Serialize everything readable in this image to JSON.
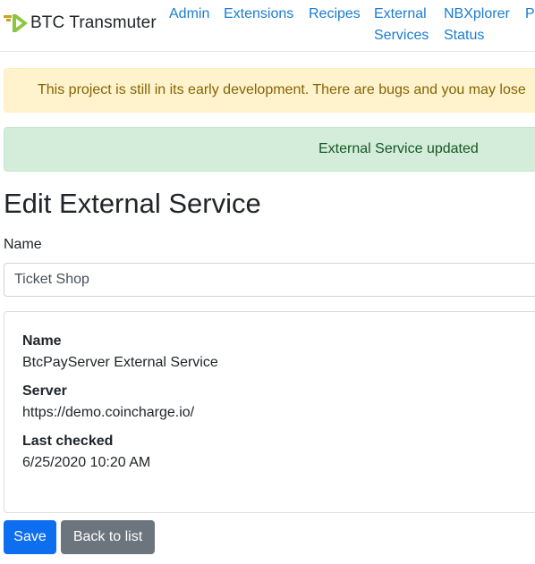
{
  "brand": {
    "name": "BTC Transmuter",
    "colors": {
      "logo_green": "#8cc63f",
      "logo_gold": "#c9a227"
    }
  },
  "nav": {
    "items": [
      {
        "label": "Admin"
      },
      {
        "label": "Extensions"
      },
      {
        "label": "Recipes"
      },
      {
        "label_line1": "External",
        "label_line2": "Services"
      },
      {
        "label_line1": "NBXplorer",
        "label_line2": "Status"
      },
      {
        "label": "Pr"
      }
    ],
    "link_color": "#1a7cd3"
  },
  "alerts": {
    "warning": "This project is still in its early development. There are bugs and you may lose",
    "success": "External Service updated"
  },
  "page": {
    "title": "Edit External Service"
  },
  "form": {
    "name_label": "Name",
    "name_value": "Ticket Shop"
  },
  "details": {
    "name_label": "Name",
    "name_value": "BtcPayServer External Service",
    "server_label": "Server",
    "server_value": "https://demo.coincharge.io/",
    "last_checked_label": "Last checked",
    "last_checked_value": "6/25/2020 10:20 AM"
  },
  "actions": {
    "save_label": "Save",
    "back_label": "Back to list"
  }
}
